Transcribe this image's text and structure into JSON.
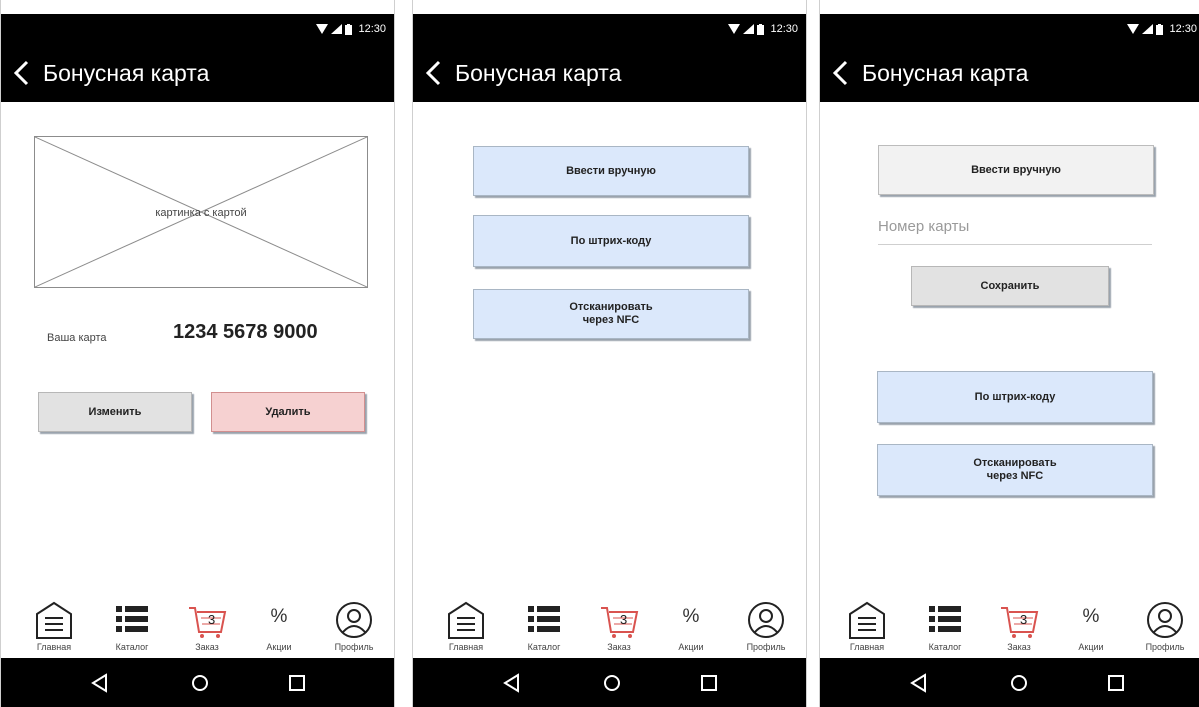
{
  "status": {
    "time": "12:30"
  },
  "app": {
    "title": "Бонусная карта"
  },
  "screen1": {
    "image_placeholder": "картинка с картой",
    "card_label": "Ваша карта",
    "card_number": "1234 5678 9000",
    "edit_button": "Изменить",
    "delete_button": "Удалить"
  },
  "screen2": {
    "manual_button": "Ввести вручную",
    "barcode_button": "По штрих-коду",
    "nfc_button": "Отсканировать\nчерез NFC"
  },
  "screen3": {
    "manual_button": "Ввести вручную",
    "card_input_placeholder": "Номер карты",
    "save_button": "Сохранить",
    "barcode_button": "По штрих-коду",
    "nfc_button": "Отсканировать\nчерез NFC"
  },
  "nav": {
    "items": [
      {
        "label": "Главная",
        "icon": "home-icon"
      },
      {
        "label": "Каталог",
        "icon": "catalog-icon"
      },
      {
        "label": "Заказ",
        "icon": "cart-icon",
        "badge": "3"
      },
      {
        "label": "Акции",
        "icon": "percent-icon",
        "glyph": "%"
      },
      {
        "label": "Профиль",
        "icon": "profile-icon"
      }
    ]
  },
  "colors": {
    "bar": "#000000",
    "button_blue": "#dbe8fb",
    "button_red": "#f6d1d1",
    "button_gray": "#e2e2e2",
    "cart_red": "#d9534f"
  }
}
